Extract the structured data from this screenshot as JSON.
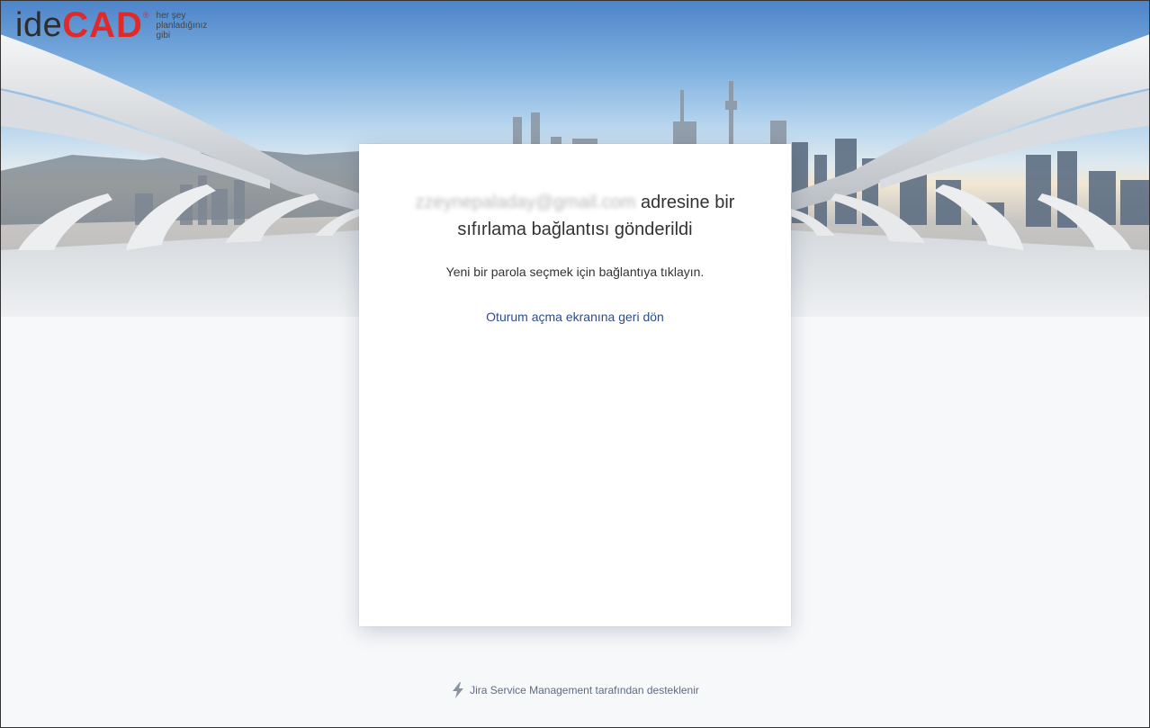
{
  "brand": {
    "logo_ide": "ide",
    "logo_cad": "CAD",
    "logo_reg": "®",
    "tagline": "her şey planladığınız gibi",
    "accent": "#e02a2a"
  },
  "card": {
    "email": "zzeynepaladay@gmail.com",
    "title_rest": "adresine bir sıfırlama bağlantısı gönderildi",
    "description": "Yeni bir parola seçmek için bağlantıya tıklayın.",
    "back_link": "Oturum açma ekranına geri dön"
  },
  "footer": {
    "powered_by": "Jira Service Management tarafından desteklenir",
    "icon": "lightning-bolt-icon"
  }
}
